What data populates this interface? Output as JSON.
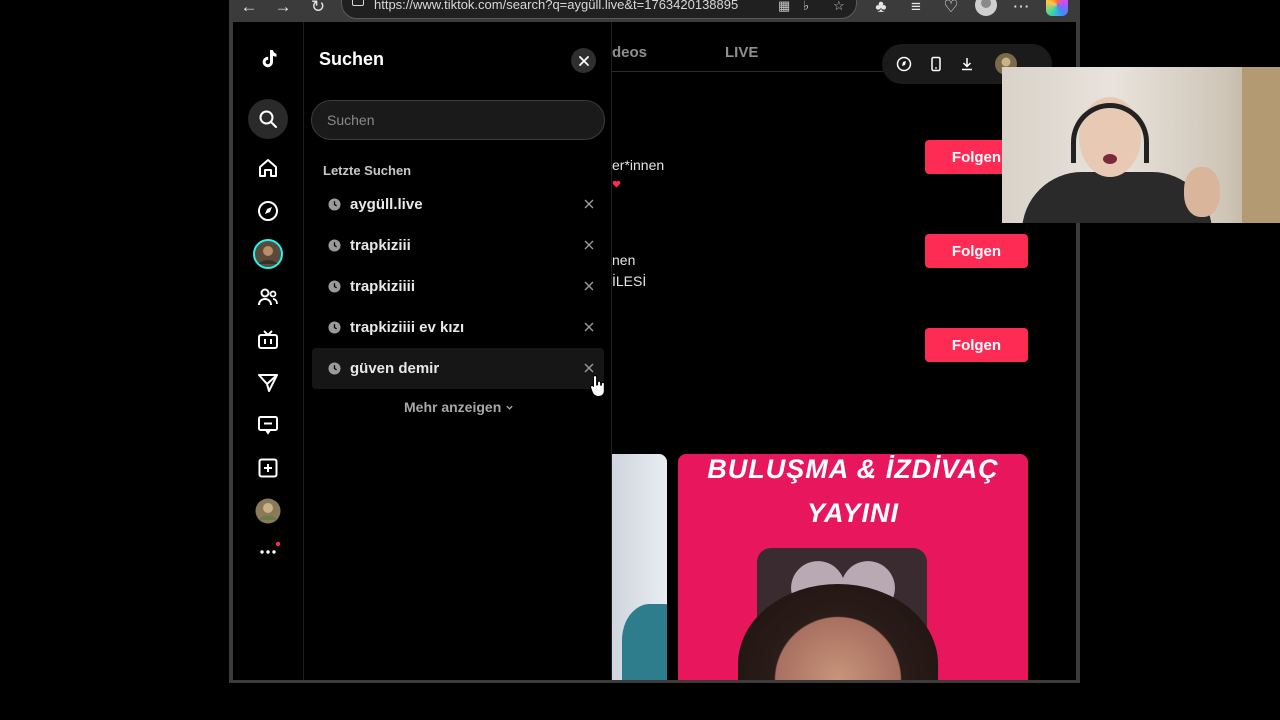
{
  "browser": {
    "url": "https://www.tiktok.com/search?q=aygüll.live&t=1763420138895"
  },
  "nav": {
    "items": [
      "tiktok-logo",
      "search",
      "home",
      "explore",
      "following-avatar",
      "friends",
      "live",
      "messages",
      "inbox",
      "upload",
      "profile",
      "more"
    ]
  },
  "search_panel": {
    "title": "Suchen",
    "input_placeholder": "Suchen",
    "recent_heading": "Letzte Suchen",
    "recent": [
      "aygüll.live",
      "trapkiziii",
      "trapkiziiii",
      "trapkiziiii ev kızı",
      "güven demir"
    ],
    "show_more": "Mehr anzeigen"
  },
  "main": {
    "tabs": [
      "deos",
      "LIVE"
    ],
    "partial_texts": [
      "er*innen",
      "nen",
      "İLESİ"
    ],
    "follow_label": "Folgen",
    "thumbnail": {
      "line1": "BULUŞMA & İZDİVAÇ",
      "line2": "YAYINI"
    }
  },
  "colors": {
    "accent": "#fe2c55",
    "background": "#000000",
    "panel": "#1a1a1a"
  }
}
